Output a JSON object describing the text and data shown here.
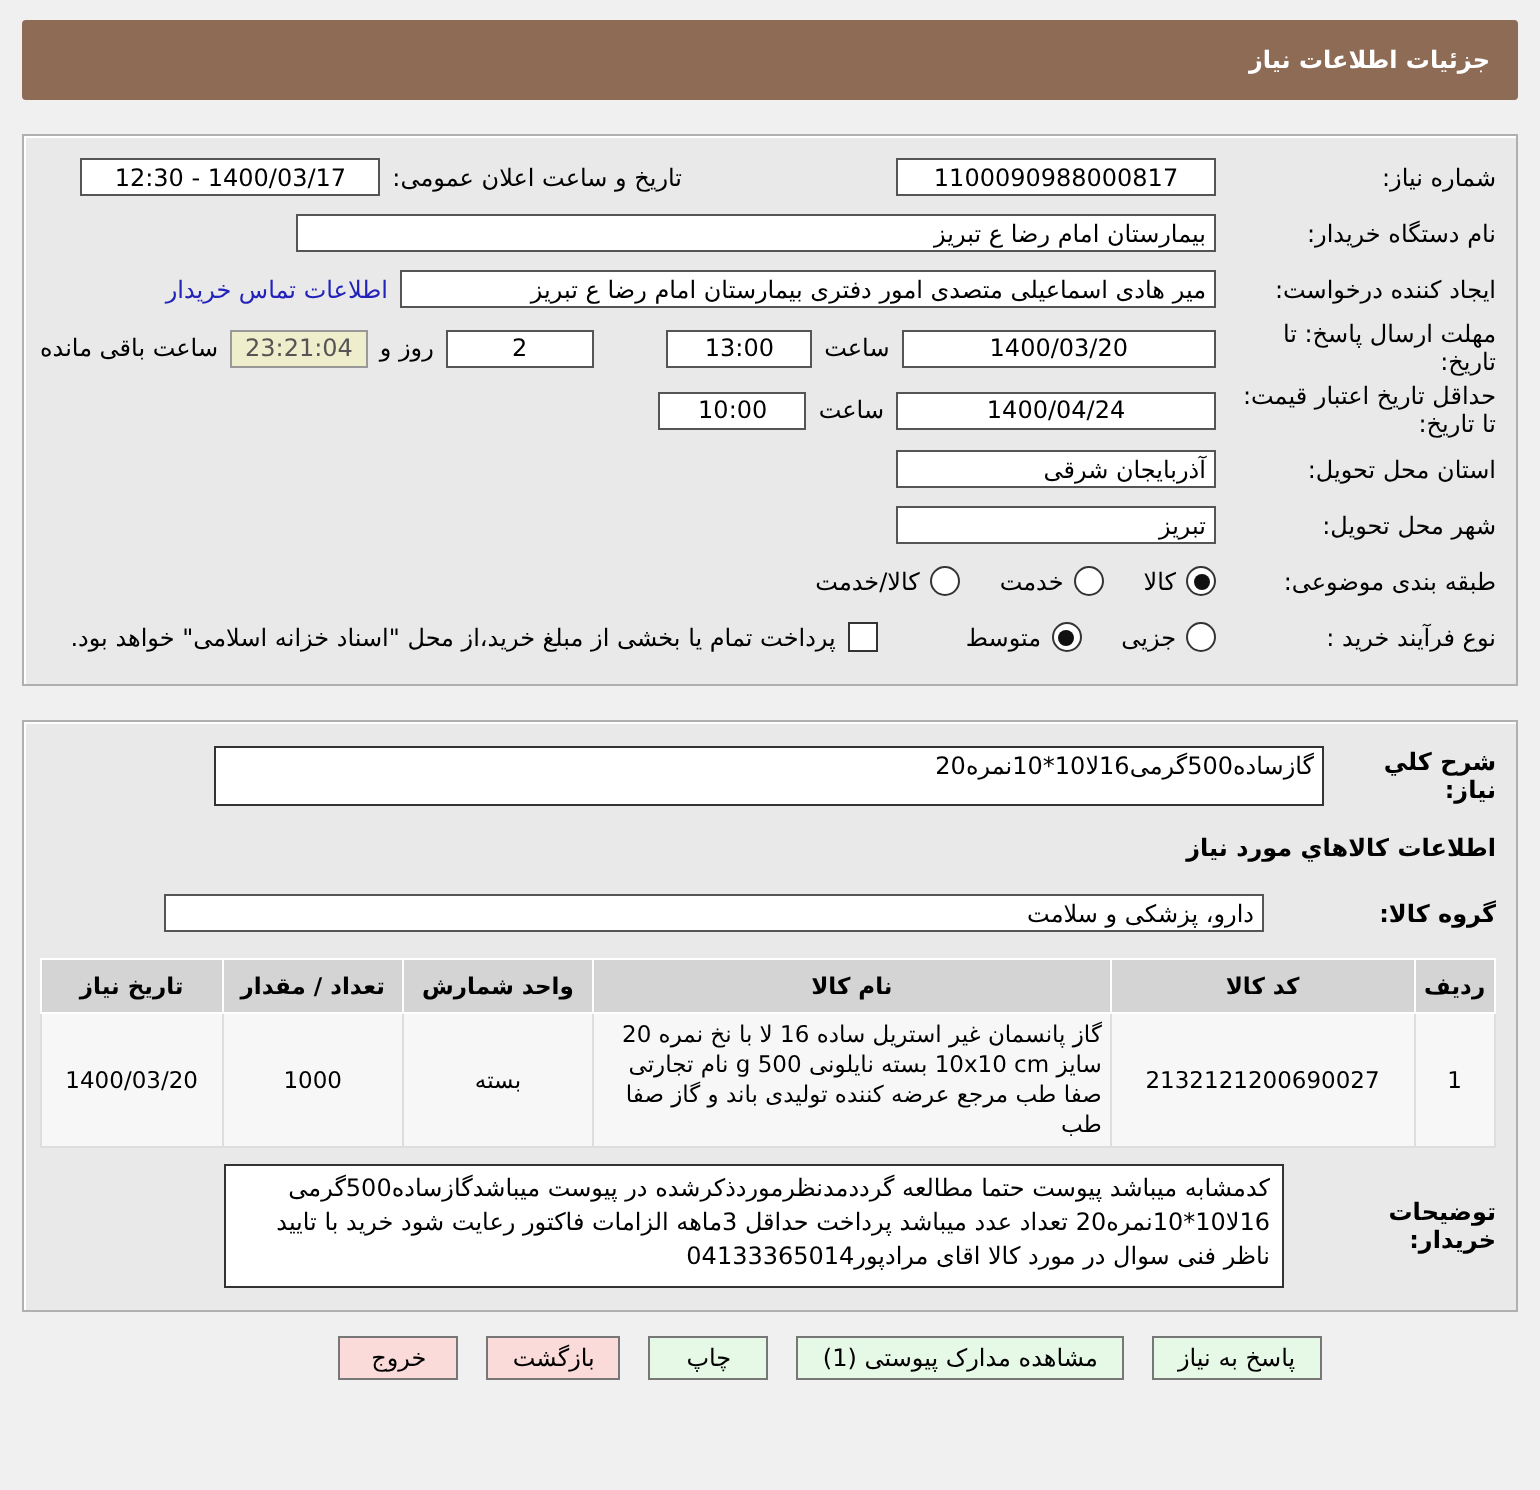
{
  "header": {
    "title": "جزئیات اطلاعات نیاز"
  },
  "need_number": {
    "label": "شماره نیاز:",
    "value": "1100090988000817"
  },
  "announce": {
    "label": "تاریخ و ساعت اعلان عمومی:",
    "value": "1400/03/17 - 12:30"
  },
  "buyer_org": {
    "label": "نام دستگاه خریدار:",
    "value": "بیمارستان امام رضا  ع  تبریز"
  },
  "creator": {
    "label": "ایجاد کننده درخواست:",
    "value": "میر هادی  اسماعیلی متصدی امور دفتری بیمارستان امام رضا  ع  تبریز",
    "link": "اطلاعات تماس خریدار"
  },
  "reply_deadline": {
    "label": "مهلت ارسال پاسخ: تا تاریخ:",
    "date": "1400/03/20",
    "time_label": "ساعت",
    "time": "13:00",
    "days": "2",
    "days_label": "روز و",
    "remaining": "23:21:04",
    "remaining_label": "ساعت باقی مانده"
  },
  "price_validity": {
    "label": "حداقل تاریخ اعتبار قیمت: تا تاریخ:",
    "date": "1400/04/24",
    "time_label": "ساعت",
    "time": "10:00"
  },
  "province": {
    "label": "استان محل تحویل:",
    "value": "آذربایجان شرقی"
  },
  "city": {
    "label": "شهر محل تحویل:",
    "value": "تبریز"
  },
  "category": {
    "label": "طبقه بندی موضوعی:",
    "options": [
      {
        "label": "کالا",
        "selected": true
      },
      {
        "label": "خدمت",
        "selected": false
      },
      {
        "label": "کالا/خدمت",
        "selected": false
      }
    ]
  },
  "process": {
    "label": "نوع فرآیند خرید :",
    "options": [
      {
        "label": "جزیی",
        "selected": false
      },
      {
        "label": "متوسط",
        "selected": true
      }
    ],
    "treasury": {
      "checked": false,
      "label": "پرداخت تمام یا بخشی از مبلغ خرید،از محل \"اسناد خزانه اسلامی\" خواهد بود."
    }
  },
  "description": {
    "label": "شرح کلي نياز:",
    "value": "گازساده500گرمی16لا10*10نمره20"
  },
  "goods_heading": "اطلاعات کالاهاي مورد نياز",
  "goods_group": {
    "label": "گروه کالا:",
    "value": "دارو، پزشکی و سلامت"
  },
  "table": {
    "columns": [
      "ردیف",
      "کد کالا",
      "نام کالا",
      "واحد شمارش",
      "تعداد / مقدار",
      "تاریخ نیاز"
    ],
    "rows": [
      [
        "1",
        "2132121200690027",
        "گاز پانسمان غیر استریل ساده 16 لا با نخ نمره 20 سایز 10x10 cm بسته نایلونی 500 g نام تجارتی صفا طب مرجع عرضه کننده تولیدی باند و گاز صفا طب",
        "بسته",
        "1000",
        "1400/03/20"
      ]
    ]
  },
  "buyer_notes": {
    "label": "توضیحات خریدار:",
    "value": "کدمشابه میباشد پیوست حتما مطالعه گرددمدنظرموردذکرشده در پیوست میباشدگازساده500گرمی 16لا10*10نمره20 تعداد عدد میباشد پرداخت حداقل 3ماهه الزامات فاکتور رعایت شود خرید با تایید ناظر فنی سوال در مورد کالا اقای مرادپور04133365014"
  },
  "buttons": [
    {
      "label": "پاسخ به نیاز",
      "kind": "go"
    },
    {
      "label": "مشاهده مدارک پیوستی (1)",
      "kind": "go"
    },
    {
      "label": "چاپ",
      "kind": "go"
    },
    {
      "label": "بازگشت",
      "kind": "stop"
    },
    {
      "label": "خروج",
      "kind": "stop"
    }
  ]
}
